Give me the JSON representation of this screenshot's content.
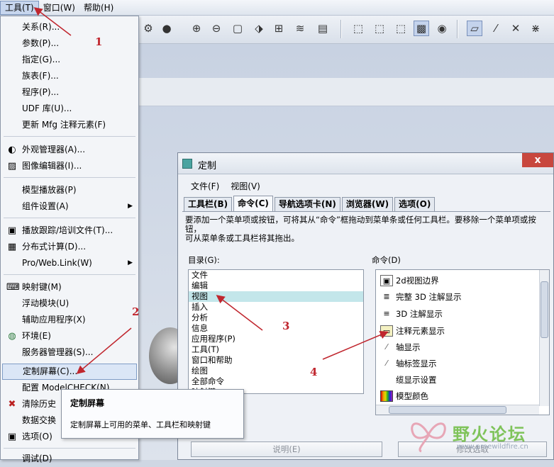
{
  "menubar": {
    "items": [
      "工具(T)",
      "窗口(W)",
      "帮助(H)"
    ]
  },
  "tools_menu": {
    "items": [
      {
        "label": "关系(R)...",
        "icon": ""
      },
      {
        "label": "参数(P)...",
        "icon": ""
      },
      {
        "label": "指定(G)...",
        "icon": ""
      },
      {
        "label": "族表(F)...",
        "icon": ""
      },
      {
        "label": "程序(P)...",
        "icon": ""
      },
      {
        "label": "UDF 库(U)...",
        "icon": ""
      },
      {
        "label": "更新 Mfg 注释元素(F)",
        "icon": ""
      },
      {
        "label": "外观管理器(A)...",
        "icon": "appearance-icon"
      },
      {
        "label": "图像编辑器(I)...",
        "icon": "image-editor-icon"
      },
      {
        "label": "模型播放器(P)",
        "icon": ""
      },
      {
        "label": "组件设置(A)",
        "icon": "",
        "submenu": true
      },
      {
        "label": "播放跟踪/培训文件(T)...",
        "icon": "playback-icon"
      },
      {
        "label": "分布式计算(D)...",
        "icon": "distributed-icon"
      },
      {
        "label": "Pro/Web.Link(W)",
        "icon": "",
        "submenu": true
      },
      {
        "label": "映射键(M)",
        "icon": "mapkey-icon"
      },
      {
        "label": "浮动模块(U)",
        "icon": ""
      },
      {
        "label": "辅助应用程序(X)",
        "icon": ""
      },
      {
        "label": "环境(E)",
        "icon": "environment-icon"
      },
      {
        "label": "服务器管理器(S)...",
        "icon": ""
      },
      {
        "label": "定制屏幕(C)...",
        "icon": ""
      },
      {
        "label": "配置 ModelCHECK(N)",
        "icon": ""
      },
      {
        "label": "清除历史",
        "icon": "clear-icon"
      },
      {
        "label": "数据交换",
        "icon": ""
      },
      {
        "label": "选项(O)",
        "icon": "options-icon"
      },
      {
        "label": "调试(D)",
        "icon": ""
      }
    ]
  },
  "tooltip": {
    "title": "定制屏幕",
    "body": "定制屏幕上可用的菜单、工具栏和映射键"
  },
  "dialog": {
    "title": "定制",
    "close": "x",
    "menus": [
      "文件(F)",
      "视图(V)"
    ],
    "tabs": [
      "工具栏(B)",
      "命令(C)",
      "导航选项卡(N)",
      "浏览器(W)",
      "选项(O)"
    ],
    "active_tab": "命令(C)",
    "instructions": "要添加一个菜单项或按钮，可将其从“命令”框拖动到菜单条或任何工具栏。要移除一个菜单项或按钮，\n可从菜单条或工具栏将其拖出。",
    "category_label": "目录(G):",
    "categories": [
      "文件",
      "编辑",
      "视图",
      "插入",
      "分析",
      "信息",
      "应用程序(P)",
      "工具(T)",
      "窗口和帮助",
      "绘图",
      "全部命令",
      "映射键"
    ],
    "selected_category": "视图",
    "commands_label": "命令(D)",
    "commands": [
      {
        "label": "2d视图边界",
        "icon": "view-boundary-icon",
        "glyph": "▣"
      },
      {
        "label": "完整 3D 注解显示",
        "icon": "full-3d-annotation-icon",
        "glyph": "≣"
      },
      {
        "label": "3D 注解显示",
        "icon": "3d-annotation-icon",
        "glyph": "≡"
      },
      {
        "label": "注释元素显示",
        "icon": "annotation-element-icon",
        "glyph": "▭"
      },
      {
        "label": "轴显示",
        "icon": "axis-icon",
        "glyph": "⁄"
      },
      {
        "label": "轴标签显示",
        "icon": "axis-tag-icon",
        "glyph": "⁄"
      },
      {
        "label": "缆显示设置",
        "icon": "cable-icon",
        "glyph": ""
      },
      {
        "label": "模型颜色",
        "icon": "model-color-icon",
        "glyph": ""
      }
    ],
    "desc_button": "说明(E)",
    "modify_button": "修改选取"
  },
  "annotations": [
    "1",
    "2",
    "3",
    "4"
  ],
  "watermark": {
    "text": "野火论坛",
    "url": "www.proewildfire.cn"
  },
  "colors": {
    "annotation": "#c0262e",
    "selected_category": "#c3e6ea",
    "watermark_green": "#7fc35a",
    "close_button": "#c8473e"
  }
}
